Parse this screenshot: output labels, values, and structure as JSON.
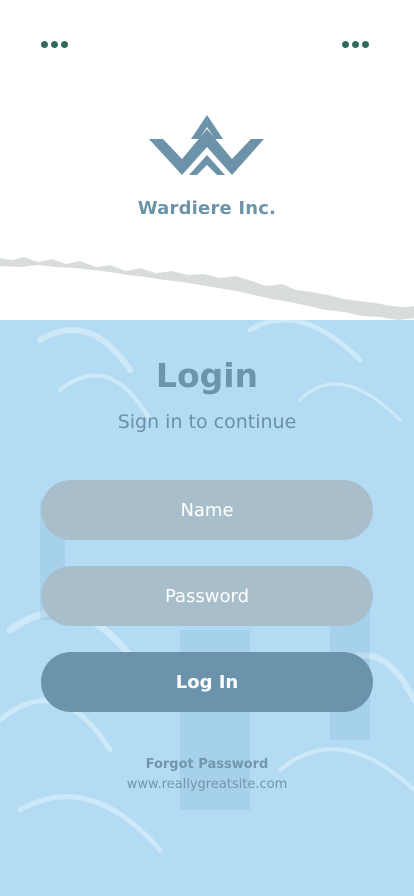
{
  "colors": {
    "dots": "#2f6a5c",
    "brand": "#6d93aa",
    "body_bg": "#b3dcf4",
    "title": "#6b94ad",
    "subtitle": "#6b8fa6",
    "field_bg": "#a8bfcb",
    "field_text": "#ffffff",
    "button_bg": "#6b93ab",
    "button_text": "#ffffff",
    "footer_text": "#7296ab",
    "paper_white": "#ffffff",
    "paper_edge": "#d9dcdc"
  },
  "header": {
    "menu_left_icon": "more-horizontal-icon",
    "menu_right_icon": "more-horizontal-icon",
    "logo_icon": "double-chevron-logo-icon",
    "brand_name": "Wardiere Inc."
  },
  "login": {
    "title": "Login",
    "subtitle": "Sign in to continue",
    "name_placeholder": "Name",
    "password_placeholder": "Password",
    "button_label": "Log In",
    "forgot_label": "Forgot Password",
    "website": "www.reallygreatsite.com"
  }
}
